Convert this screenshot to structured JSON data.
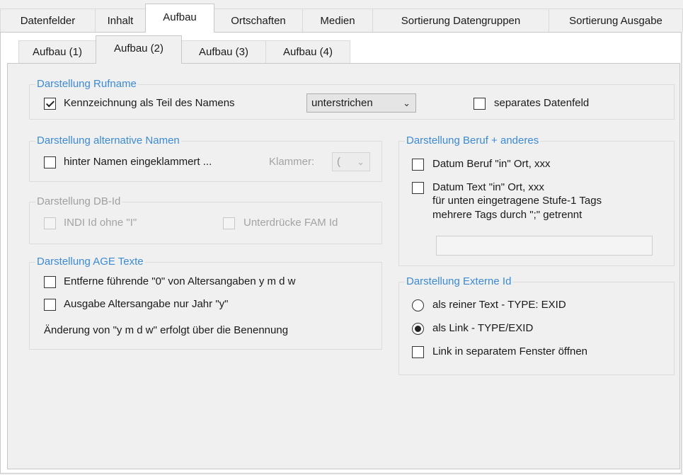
{
  "main_tabs": [
    "Datenfelder",
    "Inhalt",
    "Aufbau",
    "Ortschaften",
    "Medien",
    "Sortierung Datengruppen",
    "Sortierung Ausgabe"
  ],
  "sub_tabs": [
    "Aufbau (1)",
    "Aufbau (2)",
    "Aufbau (3)",
    "Aufbau (4)"
  ],
  "rufname": {
    "title": "Darstellung Rufname",
    "kennzeichnung_label": "Kennzeichnung als Teil des Namens",
    "kennzeichnung_checked": true,
    "style_value": "unterstrichen",
    "separates_label": "separates Datenfeld",
    "separates_checked": false
  },
  "alt_namen": {
    "title": "Darstellung alternative Namen",
    "hinter_label": "hinter Namen eingeklammert ...",
    "klammer_label": "Klammer:",
    "klammer_value": "("
  },
  "db_id": {
    "title": "Darstellung DB-Id",
    "indi_label": "INDI Id ohne \"I\"",
    "fam_label": "Unterdrücke FAM Id"
  },
  "age": {
    "title": "Darstellung AGE Texte",
    "entferne_label": "Entferne führende \"0\" von Altersangaben y m d w",
    "ausgabe_label": "Ausgabe Altersangabe nur Jahr \"y\"",
    "note": "Änderung von \"y m d w\" erfolgt über die Benennung"
  },
  "beruf": {
    "title": "Darstellung Beruf + anderes",
    "datum_beruf_label": "Datum Beruf \"in\" Ort, xxx",
    "datum_text_label": "Datum Text \"in\" Ort, xxx",
    "hint_line1": "für unten eingetragene Stufe-1 Tags",
    "hint_line2": "mehrere Tags durch \";\" getrennt",
    "tags_value": ""
  },
  "externe_id": {
    "title": "Darstellung Externe Id",
    "option_text": "als reiner Text - TYPE: EXID",
    "option_link": "als Link - TYPE/EXID",
    "selected": "als Link - TYPE/EXID",
    "separate_window_label": "Link in separatem Fenster öffnen"
  },
  "icons": {
    "combo_arrow": "chevron-down-icon"
  }
}
